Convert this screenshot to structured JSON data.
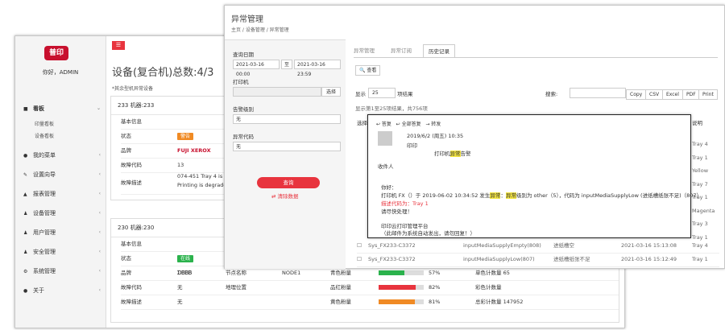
{
  "back": {
    "logo_text": "普印",
    "greeting": "你好，ADMIN",
    "menu_button": "☰",
    "nav": [
      {
        "label": "看板",
        "icon": "■",
        "sub": [
          "印量看板",
          "设备看板"
        ]
      },
      {
        "label": "我的菜单",
        "icon": "●"
      },
      {
        "label": "设置向导",
        "icon": "✎"
      },
      {
        "label": "报表管理",
        "icon": "▲"
      },
      {
        "label": "设备管理",
        "icon": "♟"
      },
      {
        "label": "用户管理",
        "icon": "♟"
      },
      {
        "label": "安全管理",
        "icon": "♟"
      },
      {
        "label": "系统管理",
        "icon": "⚙"
      },
      {
        "label": "关于",
        "icon": "●"
      }
    ],
    "title": "设备(复合机)总数:4/3",
    "note": "*其余型机异常设备",
    "panel1": {
      "header": "233 机器:233",
      "rows": [
        {
          "label": "基本信息",
          "value": ""
        },
        {
          "label": "状态",
          "badge": "警告"
        },
        {
          "label": "品牌",
          "value": "FUJI XEROX"
        },
        {
          "label": "故障代码",
          "value": "13"
        },
        {
          "label": "故障描述",
          "value": "074-451 Tray 4 is out",
          "value2": "Printing is degraded"
        }
      ]
    },
    "panel2": {
      "header": "230 机器:230",
      "rows": [
        {
          "label": "基本信息"
        },
        {
          "label": "状态",
          "badge": "在线"
        },
        {
          "label": "品牌",
          "value": "ᗤᏴᏴᏴ",
          "c2": "节点名称",
          "c3": "NODE1",
          "c4": "青色粉量",
          "pct": "57%",
          "pv": 0.57,
          "col": "#2bb24c",
          "c5": "单色计数量 65"
        },
        {
          "label": "故障代码",
          "value": "无",
          "c2": "地理位置",
          "c3": "",
          "c4": "品红粉量",
          "pct": "82%",
          "pv": 0.82,
          "col": "#e8343e",
          "c5": "彩色计数量"
        },
        {
          "label": "故障描述",
          "value": "无",
          "c2": "",
          "c3": "",
          "c4": "黄色粉量",
          "pct": "81%",
          "pv": 0.81,
          "col": "#f08a24",
          "c5": "总彩计数量 147952"
        }
      ]
    }
  },
  "front": {
    "title": "异常管理",
    "crumb": "主页  /  设备管理  /  异常管理",
    "f_date": "查询日期",
    "d1": "2021-03-16 00:00",
    "d_sep": "至",
    "d2": "2021-03-16 23:59",
    "f_printer": "打印机",
    "select_btn": "选择",
    "f_level": "告警级别",
    "level_val": "无",
    "f_code": "异常代码",
    "code_val": "无",
    "query_btn": "查询",
    "clear_btn": "⇄ 清除数据",
    "tabs": [
      "异常管理",
      "异常订阅",
      "历史记录"
    ],
    "view_btn": "🔍 查看",
    "show_label": "显示",
    "page_size": "25",
    "show_suffix": "项结果",
    "search_label": "搜索:",
    "exports": [
      "Copy",
      "CSV",
      "Excel",
      "PDF",
      "Print"
    ],
    "result_info": "显示第1至25项结果，共756项",
    "col_first": "选择",
    "col_last": "说明",
    "side_vals": [
      "Tray 4",
      "Tray 1",
      "Yellow",
      "Tray 7",
      "Tray 1",
      "Magenta",
      "Tray 3",
      "Tray 1"
    ],
    "rows": [
      {
        "id": "Sys_FX233-C3372",
        "type": "inputMediaSupplyEmpty(808)",
        "st": "进纸槽空",
        "time": "2021-03-16 15:13:08",
        "loc": "Tray 4"
      },
      {
        "id": "Sys_FX233-C3372",
        "type": "inputMediaSupplyLow(807)",
        "st": "进纸槽纸张不足",
        "time": "2021-03-16 15:12:49",
        "loc": "Tray 1"
      }
    ]
  },
  "popup": {
    "actions": [
      "↩ 答复",
      "↩ 全部答复",
      "→ 转发"
    ],
    "date": "2019/6/2 (周五) 10:35",
    "from": "印印",
    "subject_pre": "打印机",
    "subject_hl": "异常",
    "subject_post": "告警",
    "to_label": "收件人",
    "greet": "你好：",
    "body_a": "打印机 FX（）于 2019-06-02 10:34:52 发生",
    "body_hl1": "异常",
    "body_b": "：",
    "body_hl2": "异常",
    "body_c": "级别为 other（5），代码为 inputMediaSupplyLow (进纸槽纸张不足)（807）",
    "body_d": "描述代码为：Tray 1",
    "body_e": "请尽快处理！",
    "sign1": "印印云打印管理平台",
    "sign2": "（此邮件为系统自动发出，请勿回复！）"
  }
}
